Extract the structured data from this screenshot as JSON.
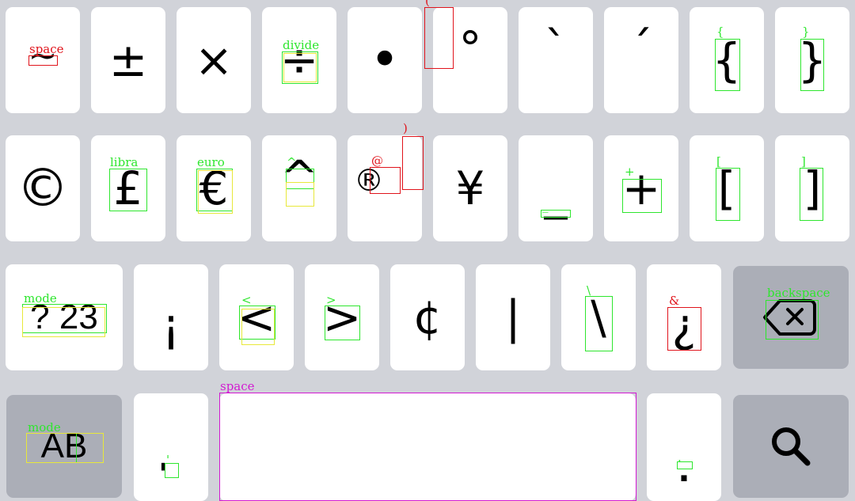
{
  "keys": {
    "tilde": "~",
    "plusminus": "±",
    "times": "×",
    "divide": "÷",
    "bullet": "•",
    "degree": "°",
    "backtick": "`",
    "acute": "´",
    "lbrace": "{",
    "rbrace": "}",
    "copyright": "©",
    "pound": "£",
    "euro": "€",
    "caret": "^",
    "registered": "®",
    "yen": "¥",
    "underscore": "_",
    "plus": "+",
    "lbracket": "[",
    "rbracket": "]",
    "mode23": "? 23",
    "inv_excl": "¡",
    "lt": "<",
    "gt": ">",
    "cent": "¢",
    "pipe": "|",
    "backslash": "\\",
    "inv_q": "¿",
    "modeAB": "AB",
    "apostrophe": "'",
    "period": "."
  },
  "labels": {
    "space1": "space",
    "divide": "divide",
    "paren_open": "(",
    "lbrace": "{",
    "rbrace": "}",
    "paren_close": ")",
    "libra": "libra",
    "euro": "euro",
    "caret": "^",
    "at": "@",
    "underscore": "_",
    "plus": "+",
    "lbracket": "[",
    "rbracket": "]",
    "mode23": "mode",
    "lt": "<",
    "gt": ">",
    "backslash": "\\",
    "amp": "&",
    "backspace": "backspace",
    "modeAB": "mode",
    "apostrophe": "'",
    "period": ".",
    "space2": "space"
  },
  "icons": {
    "backspace": "backspace-icon",
    "search": "search-icon"
  },
  "colors": {
    "background": "#d1d3d9",
    "key": "#ffffff",
    "dark_key": "#abaeb7",
    "annotation_green": "#2ee62e",
    "annotation_red": "#e0141c",
    "annotation_magenta": "#d21ad2",
    "annotation_yellow": "#e8e83a"
  }
}
